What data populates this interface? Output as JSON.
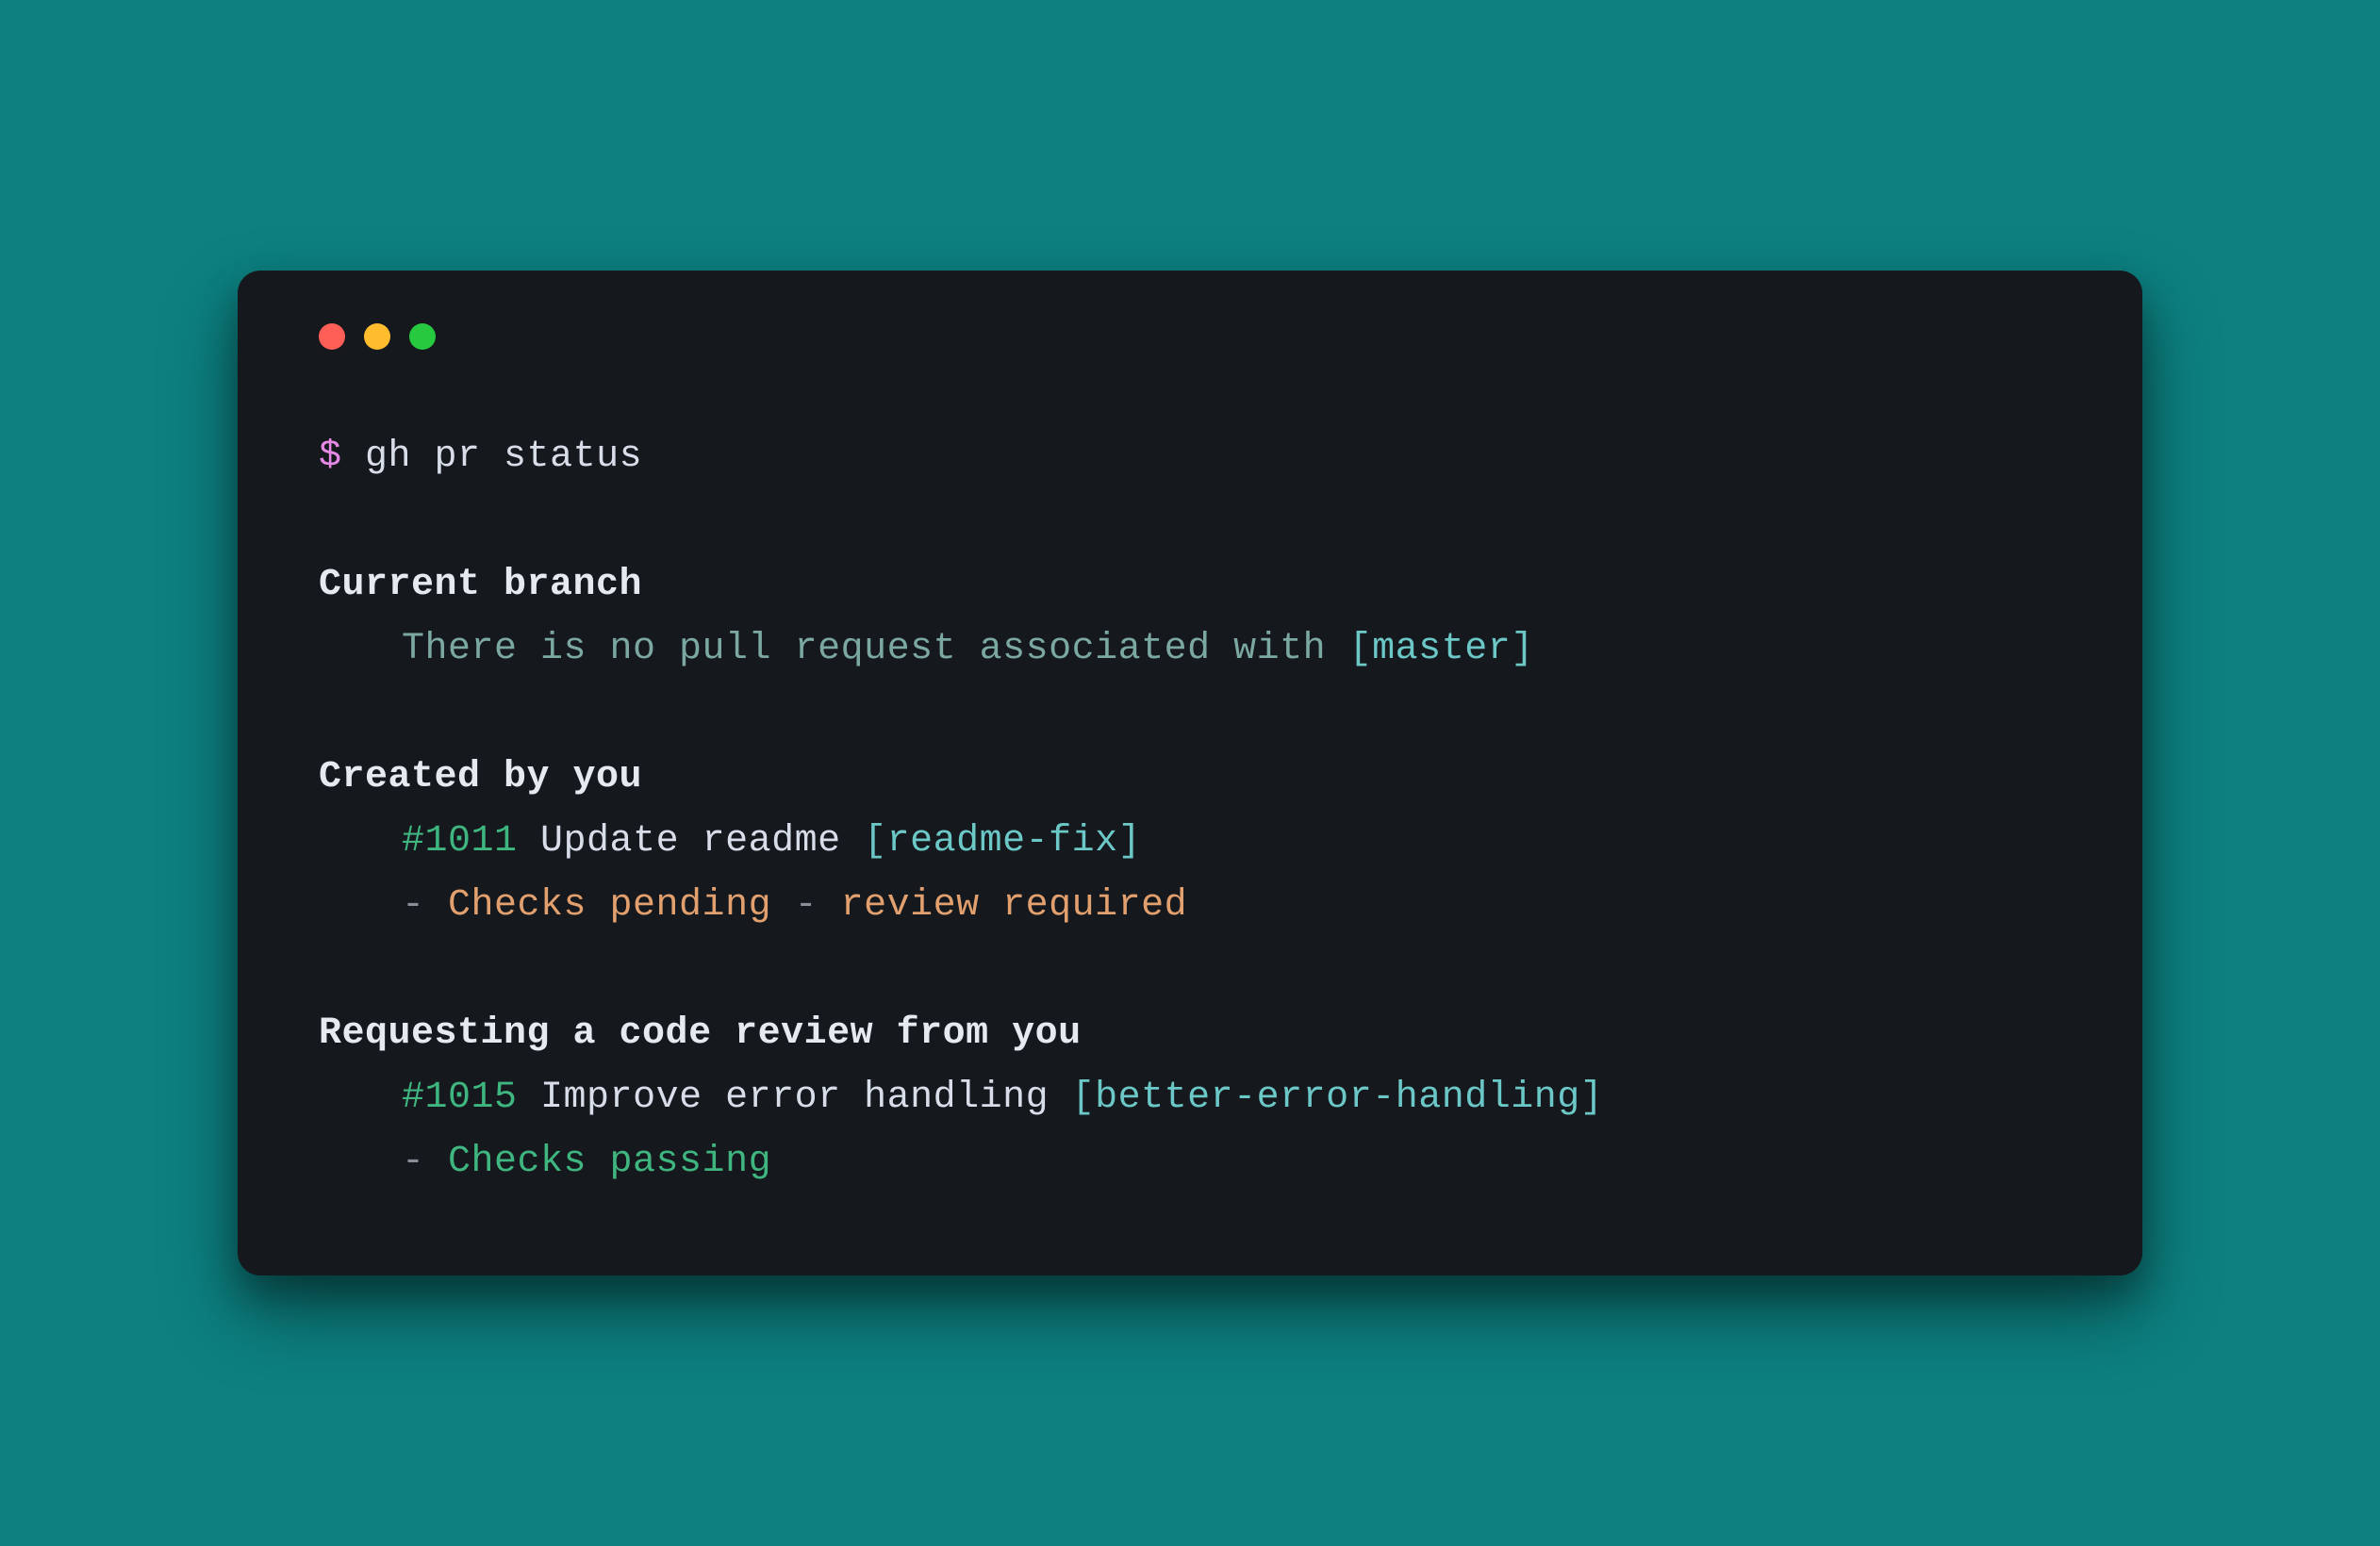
{
  "prompt": {
    "symbol": "$",
    "command": "gh pr status"
  },
  "sections": {
    "current_branch": {
      "header": "Current branch",
      "message": "There is no pull request associated with ",
      "branch": "[master]"
    },
    "created_by_you": {
      "header": "Created by you",
      "pr_number": "#1011",
      "pr_title": "Update readme ",
      "pr_branch": "[readme-fix]",
      "status_dash1": "- ",
      "status_checks": "Checks pending",
      "status_dash2": " - ",
      "status_review": "review required"
    },
    "requesting_review": {
      "header": "Requesting a code review from you",
      "pr_number": "#1015",
      "pr_title": "Improve error handling ",
      "pr_branch": "[better-error-handling]",
      "status_dash": "- ",
      "status_checks": "Checks passing"
    }
  }
}
